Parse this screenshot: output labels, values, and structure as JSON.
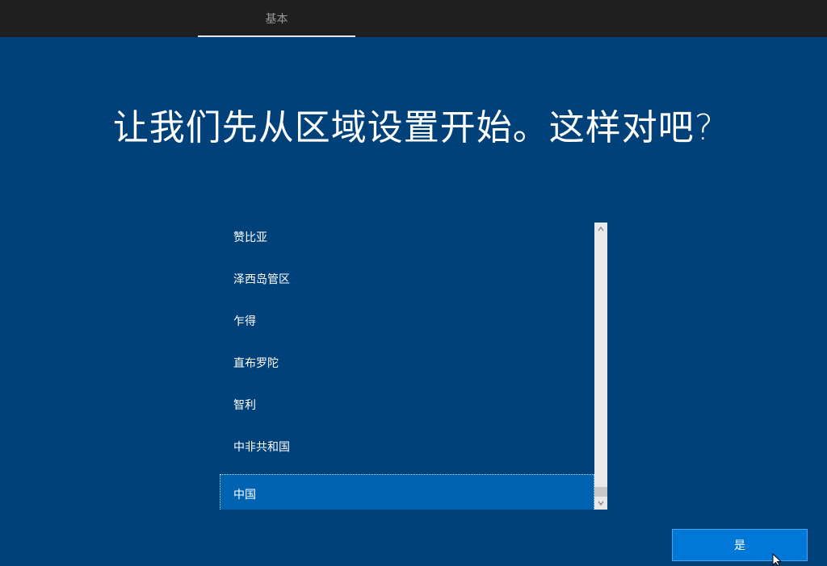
{
  "header": {
    "tab_label": "基本"
  },
  "main": {
    "title": "让我们先从区域设置开始。这样对吧?"
  },
  "region_list": {
    "items": [
      "赞比亚",
      "泽西岛管区",
      "乍得",
      "直布罗陀",
      "智利",
      "中非共和国",
      "中国"
    ],
    "selected": "中国"
  },
  "footer": {
    "yes_label": "是"
  },
  "icons": {
    "scroll_up": "chevron-up-icon",
    "scroll_down": "chevron-down-icon",
    "pointer": "mouse-pointer-icon"
  },
  "colors": {
    "background": "#00417a",
    "topbar": "#1f1f1f",
    "selected_item": "#0063b1",
    "button": "#0078d7"
  }
}
